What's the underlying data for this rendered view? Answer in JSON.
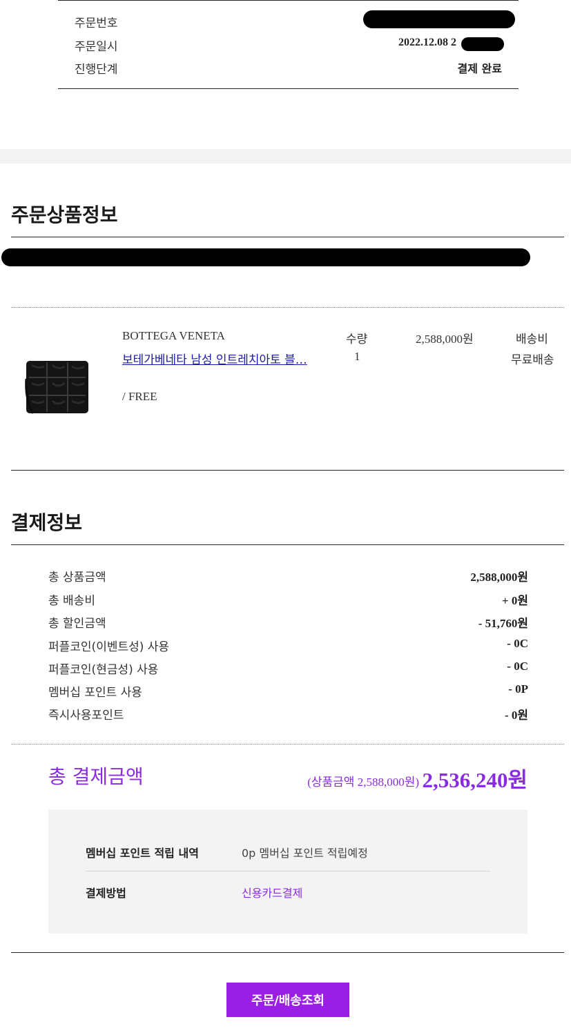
{
  "order_summary": {
    "rows": [
      {
        "label": "주문번호",
        "value": ""
      },
      {
        "label": "주문일시",
        "value": "2022.12.08 2"
      },
      {
        "label": "진행단계",
        "value": "결제 완료"
      }
    ]
  },
  "product_section": {
    "title": "주문상품정보",
    "product": {
      "brand": "BOTTEGA VENETA",
      "name": "보테가베네타 남성 인트레치아토 블…",
      "option": "/ FREE",
      "qty_label": "수량",
      "qty_value": "1",
      "price": "2,588,000원",
      "shipping_label": "배송비",
      "shipping_value": "무료배송"
    }
  },
  "payment_section": {
    "title": "결제정보",
    "rows": [
      {
        "label": "총 상품금액",
        "value": "2,588,000원"
      },
      {
        "label": "총 배송비",
        "value": "+ 0원"
      },
      {
        "label": "총 할인금액",
        "value": "- 51,760원"
      },
      {
        "label": "퍼플코인(이벤트성) 사용",
        "value": "- 0C"
      },
      {
        "label": "퍼플코인(현금성) 사용",
        "value": "- 0C"
      },
      {
        "label": "멤버십 포인트 사용",
        "value": "- 0P"
      },
      {
        "label": "즉시사용포인트",
        "value": "- 0원"
      }
    ],
    "total": {
      "label": "총 결제금액",
      "sub": "(상품금액 2,588,000원)",
      "value": "2,536,240원"
    },
    "info": {
      "points_label": "멤버십 포인트 적립 내역",
      "points_value": "0p 멤버십 포인트 적립예정",
      "method_label": "결제방법",
      "method_value": "신용카드결제"
    }
  },
  "actions": {
    "order_lookup_label": "주문/배송조회"
  },
  "colors": {
    "accent": "#8a2be2",
    "button": "#9a1ee6",
    "link": "#1a1aa6"
  }
}
